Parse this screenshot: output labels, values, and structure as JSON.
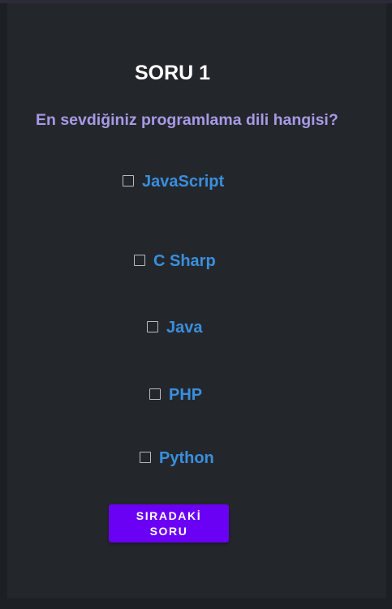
{
  "quiz": {
    "title": "SORU 1",
    "question": "En sevdiğiniz programlama dili hangisi?",
    "options": [
      {
        "label": "JavaScript",
        "checked": false
      },
      {
        "label": "C Sharp",
        "checked": false
      },
      {
        "label": "Java",
        "checked": false
      },
      {
        "label": "PHP",
        "checked": false
      },
      {
        "label": "Python",
        "checked": false
      }
    ],
    "next_button": {
      "line1": "SIRADAKİ",
      "line2": "SORU"
    }
  },
  "colors": {
    "background": "#23272c",
    "question_text": "#a79ae6",
    "option_text": "#3a8fdd",
    "button": "#6a00f4"
  }
}
